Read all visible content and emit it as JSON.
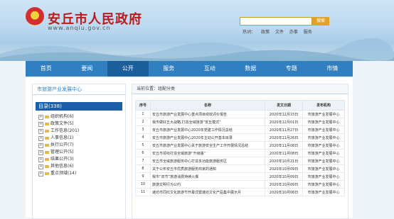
{
  "header": {
    "site_title": "安丘市人民政府",
    "site_url": "www.anqiu.gov.cn",
    "search_placeholder": "",
    "search_button": "搜索",
    "hotwords_label": "热词：",
    "hotwords": [
      "政策",
      "文件",
      "办事",
      "服务"
    ]
  },
  "nav": [
    "首页",
    "要闻",
    "公开",
    "服务",
    "互动",
    "数据",
    "专题",
    "市情"
  ],
  "nav_active_index": 2,
  "sidebar": {
    "title": "市旅游产业发展中心",
    "catalog_label": "目录(338)",
    "items": [
      "组织机构(6)",
      "政策文件(5)",
      "工作信息(201)",
      "人事信息(1)",
      "执行公开(7)",
      "管理公开(5)",
      "结果公开(3)",
      "其他信息(6)",
      "重点领域(14)"
    ]
  },
  "content": {
    "breadcrumb": "当前位置：组配分类",
    "columns": [
      "序号",
      "名称",
      "发文日期",
      "发布机构"
    ],
    "rows": [
      [
        "1",
        "安丘市旅游产业发展中心重点项目绩效评价报告",
        "2020年12月15日",
        "市旅游产业发展中心"
      ],
      [
        "2",
        "我市做好五大战略,打造全域旅游“安丘模式”",
        "2020年12月01日",
        "市旅游产业发展中心"
      ],
      [
        "3",
        "安丘市旅游产业发展中心2020年党建工作情况总结",
        "2020年11月27日",
        "市旅游产业发展中心"
      ],
      [
        "4",
        "安丘市旅游产业发展中心2020年主动公开基本目录",
        "2020年11月26日",
        "市旅游产业发展中心"
      ],
      [
        "5",
        "安丘市旅游产业发展中心关于旅游安全生产工作开展情况总结",
        "2020年11月08日",
        "市旅游产业发展中心"
      ],
      [
        "6",
        "安丘市领衔打造全域旅游“升级版”",
        "2020年11月08日",
        "市旅游产业发展中心"
      ],
      [
        "7",
        "安丘市全域旅游服务中心打造多功能旅游服务区",
        "2020年10月21日",
        "市旅游产业发展中心"
      ],
      [
        "8",
        "关于公布安丘市优质旅游服务商家的通知",
        "2020年10月09日",
        "市旅游产业发展中心"
      ],
      [
        "9",
        "我市“双节”旅游消费持续火爆",
        "2020年10月09日",
        "市旅游产业发展中心"
      ],
      [
        "10",
        "旅游文明行为公约",
        "2020年10月09日",
        "市旅游产业发展中心"
      ],
      [
        "11",
        "潍坊市同红文化旅游节开幕式暨潍坊文化产品集中展示月",
        "2020年10月08日",
        "市旅游产业发展中心"
      ]
    ]
  }
}
